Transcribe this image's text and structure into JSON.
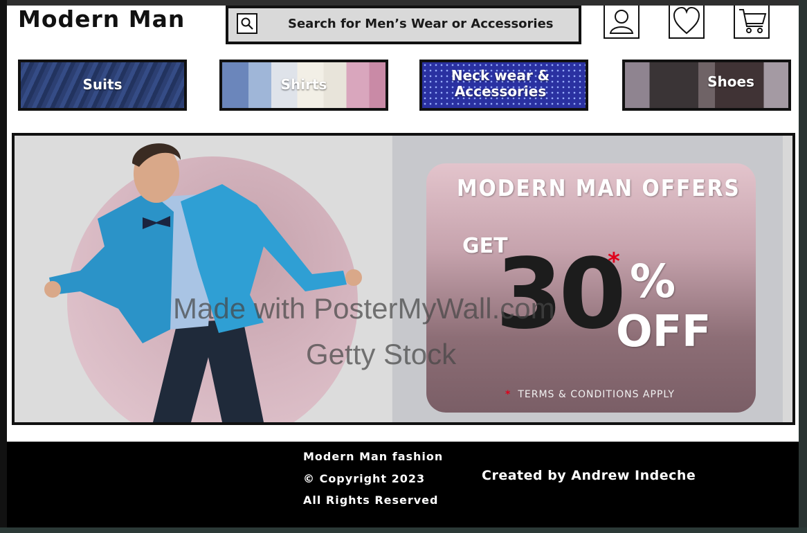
{
  "header": {
    "brand": "Modern Man",
    "search_text": "Search for Men’s Wear or Accessories"
  },
  "icons": [
    "search-icon",
    "user-icon",
    "heart-icon",
    "cart-icon"
  ],
  "categories": [
    {
      "label": "Suits"
    },
    {
      "label": "Shirts"
    },
    {
      "label": "Neck wear & Accessories"
    },
    {
      "label": "Shoes"
    }
  ],
  "banner": {
    "title": "MODERN MAN OFFERS",
    "get": "GET",
    "number": "30",
    "star": "*",
    "percent": "%",
    "off": "OFF",
    "terms_mark": "*",
    "terms": "TERMS & CONDITIONS APPLY"
  },
  "watermarks": {
    "line1": "Made with PosterMyWall.com",
    "line2": "Getty Stock"
  },
  "footer": {
    "line1": "Modern Man fashion",
    "line2": "© Copyright 2023",
    "line3": "All Rights Reserved",
    "credit": "Created by Andrew Indeche"
  },
  "colors": {
    "footer_bg": "#000000",
    "offer_star": "#e0001a",
    "search_bg": "#d9d9d9"
  }
}
